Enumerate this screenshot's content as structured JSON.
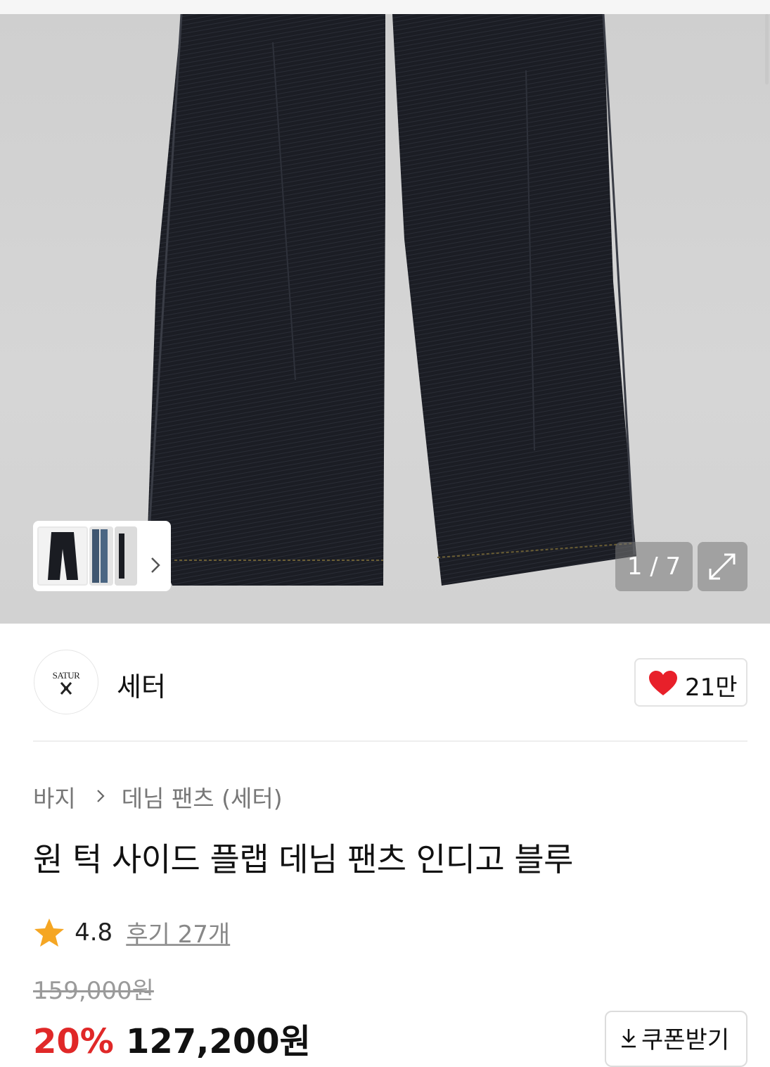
{
  "gallery": {
    "counter": "1 / 7",
    "colors": {
      "background": "#d2d2d2",
      "denim": "#1a1c22"
    }
  },
  "brand": {
    "logo_text": "SATUR",
    "name": "세터"
  },
  "like": {
    "count": "21만",
    "icon": "heart-icon"
  },
  "breadcrumb": {
    "category": "바지",
    "subcategory": "데님 팬츠 (세터)"
  },
  "product": {
    "title": "원 턱 사이드 플랩 데님 팬츠 인디고 블루",
    "rating": "4.8",
    "reviews": "후기 27개",
    "original_price": "159,000원",
    "discount": "20%",
    "sale_price": "127,200원",
    "coupon_label": "쿠폰받기"
  },
  "colors": {
    "accent_red": "#e02828",
    "star": "#f5a623",
    "heart": "#e8202a"
  }
}
